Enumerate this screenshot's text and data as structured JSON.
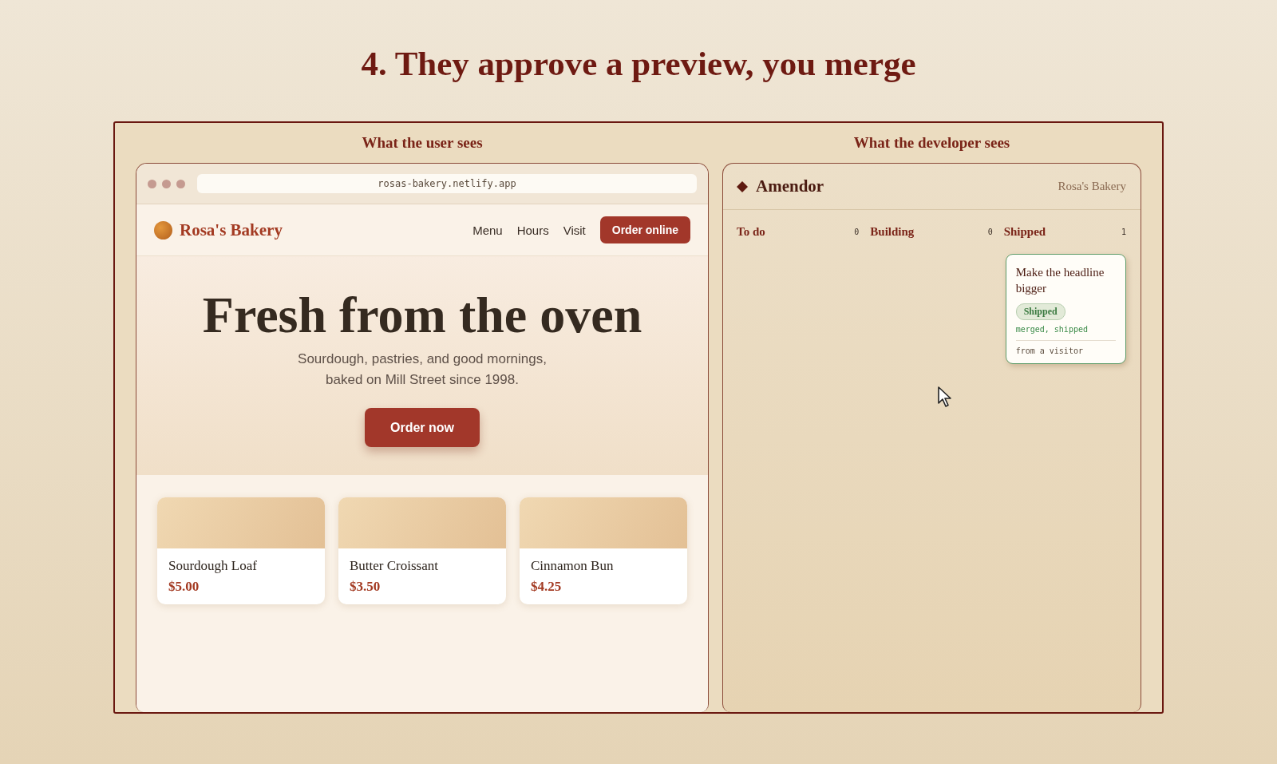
{
  "title": "4. They approve a preview, you merge",
  "user_panel": {
    "label": "What the user sees",
    "browser": {
      "url": "rosas-bakery.netlify.app",
      "brand": "Rosa's Bakery",
      "nav": [
        "Menu",
        "Hours",
        "Visit"
      ],
      "cta": "Order online",
      "hero": {
        "headline": "Fresh from the oven",
        "subtitle_lines": [
          "Sourdough, pastries, and good mornings,",
          "baked on Mill Street since 1998."
        ],
        "button": "Order now"
      },
      "products": [
        {
          "name": "Sourdough Loaf",
          "price": "$5.00"
        },
        {
          "name": "Butter Croissant",
          "price": "$3.50"
        },
        {
          "name": "Cinnamon Bun",
          "price": "$4.25"
        }
      ]
    }
  },
  "developer_panel": {
    "label": "What the developer sees",
    "app": {
      "name": "Amendor",
      "project": "Rosa's Bakery"
    },
    "columns": [
      {
        "title": "To do",
        "count": "0"
      },
      {
        "title": "Building",
        "count": "0"
      },
      {
        "title": "Shipped",
        "count": "1",
        "cards": [
          {
            "title": "Make the headline bigger",
            "status": "Shipped",
            "note": "merged, shipped",
            "source": "from a visitor"
          }
        ]
      }
    ]
  }
}
